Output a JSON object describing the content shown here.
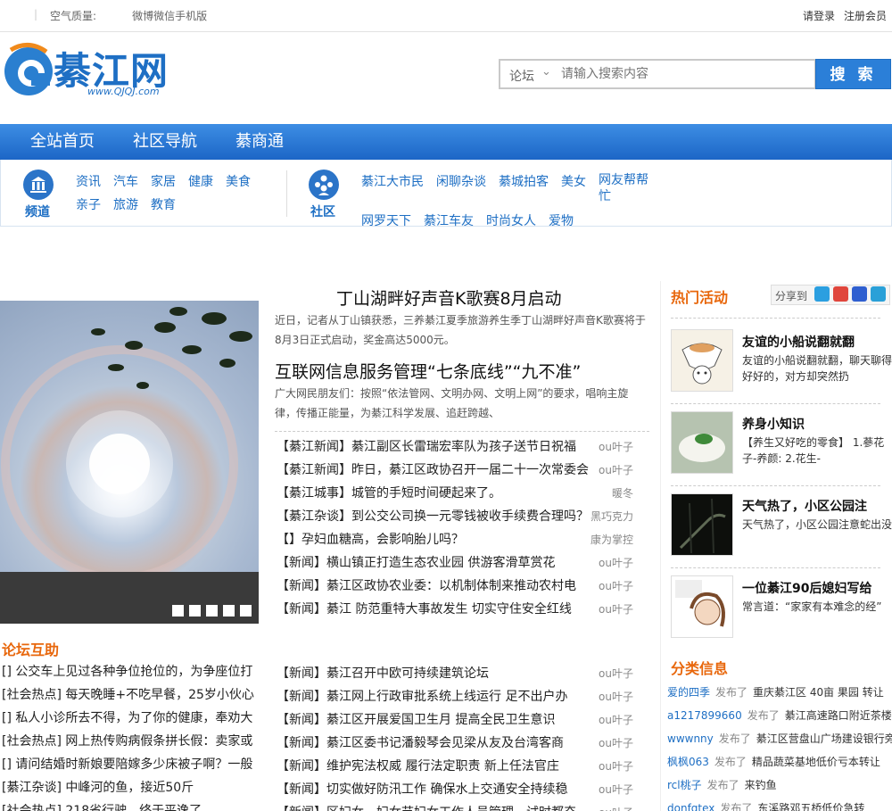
{
  "topbar": {
    "air": "空气质量:",
    "weibo": "微博",
    "weixin": "微信",
    "mobile": "手机版",
    "login": "请登录",
    "register": "注册会员"
  },
  "logo": {
    "text": "綦江网",
    "sub": "www.QJQJ.com"
  },
  "search": {
    "category": "论坛",
    "placeholder": "请输入搜索内容",
    "button": "搜 索"
  },
  "nav": [
    "全站首页",
    "社区导航",
    "綦商通"
  ],
  "channel": {
    "label": "频道",
    "links": [
      "资讯",
      "汽车",
      "家居",
      "健康",
      "美食",
      "亲子",
      "旅游",
      "教育"
    ]
  },
  "community": {
    "label": "社区",
    "links": [
      "綦江大市民",
      "闲聊杂谈",
      "綦城拍客",
      "美女",
      "网友帮帮忙",
      "网罗天下",
      "綦江车友",
      "时尚女人",
      "爱物"
    ]
  },
  "headline1": {
    "title": "丁山湖畔好声音K歌赛8月启动",
    "desc": "近日，记者从丁山镇获悉，三养綦江夏季旅游养生季丁山湖畔好声音K歌赛将于8月3日正式启动，奖金高达5000元。"
  },
  "headline2": {
    "title": "互联网信息服务管理“七条底线”“九不准”",
    "desc": "广大网民朋友们：按照“依法管网、文明办网、文明上网”的要求，唱响主旋律，传播正能量，为綦江科学发展、追赶跨越、"
  },
  "news": [
    {
      "title": "【綦江新闻】綦江副区长雷瑞宏率队为孩子送节日祝福",
      "author": "ou叶子"
    },
    {
      "title": "【綦江新闻】昨日，綦江区政协召开一届二十一次常委会",
      "author": "ou叶子"
    },
    {
      "title": "【綦江城事】城管的手短时间硬起来了。",
      "author": "暖冬"
    },
    {
      "title": "【綦江杂谈】到公交公司换一元零钱被收手续费合理吗？",
      "author": "黑巧克力"
    },
    {
      "title": "【】孕妇血糖高，会影响胎儿吗？",
      "author": "康为掌控"
    },
    {
      "title": "【新闻】横山镇正打造生态农业园 供游客滑草赏花",
      "author": "ou叶子"
    },
    {
      "title": "【新闻】綦江区政协农业委：以机制体制来推动农村电",
      "author": "ou叶子"
    },
    {
      "title": "【新闻】綦江 防范重特大事故发生 切实守住安全红线",
      "author": "ou叶子"
    },
    {
      "title": "【新闻】綦江召开中欧可持续建筑论坛",
      "author": "ou叶子"
    },
    {
      "title": "【新闻】綦江网上行政审批系统上线运行 足不出户办",
      "author": "ou叶子"
    },
    {
      "title": "【新闻】綦江区开展爱国卫生月 提高全民卫生意识",
      "author": "ou叶子"
    },
    {
      "title": "【新闻】綦江区委书记潘毅琴会见梁从友及台湾客商",
      "author": "ou叶子"
    },
    {
      "title": "【新闻】维护宪法权威 履行法定职责 新上任法官庄",
      "author": "ou叶子"
    },
    {
      "title": "【新闻】切实做好防汛工作 确保水上交通安全持续稳",
      "author": "ou叶子"
    },
    {
      "title": "【新闻】区妇女、妇女节妇女工作人员管理，试时都奋",
      "author": "ou叶子"
    }
  ],
  "forum": {
    "title": "论坛互助",
    "items": [
      "[] 公交车上见过各种争位抢位的，为争座位打",
      "[社会热点] 每天晚睡+不吃早餐，25岁小伙心",
      "[] 私人小诊所去不得，为了你的健康，奉劝大",
      "[社会热点] 网上热传购病假条拼长假：卖家或",
      "[] 请问结婚时新娘要陪嫁多少床被子啊？一般",
      "[綦江杂谈] 中峰河的鱼，接近50斤",
      "[社会热点] 218省行驶，终于平逸了"
    ]
  },
  "hot": {
    "title": "热门活动",
    "share": "分享到",
    "items": [
      {
        "title": "友谊的小船说翻就翻",
        "desc": "友谊的小船说翻就翻，聊天聊得好好的，对方却突然扔"
      },
      {
        "title": "养身小知识",
        "desc": "【养生又好吃的零食】 1.蔘花子-养颜: 2.花生-"
      },
      {
        "title": "天气热了，小区公园注",
        "desc": "天气热了，小区公园注意蛇出没"
      },
      {
        "title": "一位綦江90后媳妇写给",
        "desc": "常言道：“家家有本难念的经”"
      }
    ]
  },
  "classify": {
    "title": "分类信息",
    "posted": "发布了",
    "items": [
      {
        "user": "爱的四季",
        "text": "重庆綦江区 40亩 果园 转让"
      },
      {
        "user": "a1217899660",
        "text": "綦江高速路口附近茶楼招"
      },
      {
        "user": "wwwnny",
        "text": "綦江区营盘山广场建设银行旁"
      },
      {
        "user": "枫枫063",
        "text": "精品蔬菜基地低价亏本转让"
      },
      {
        "user": "rcl桃子",
        "text": "来钓鱼"
      },
      {
        "user": "donfgtex",
        "text": "东溪路邓五桥低价急转"
      }
    ]
  },
  "colors": {
    "accent": "#1e6fc4",
    "orange": "#e8670c",
    "nav": "#2b7fd8"
  }
}
